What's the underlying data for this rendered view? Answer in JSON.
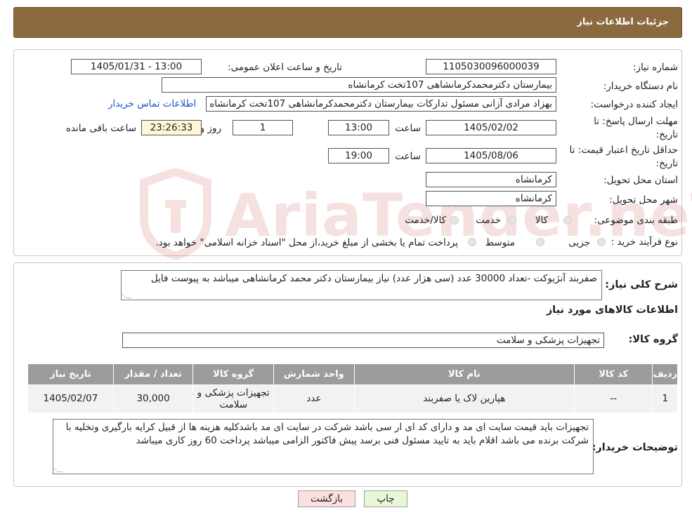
{
  "header": {
    "title": "جزئیات اطلاعات نیاز"
  },
  "watermark": {
    "text": "AriaTender.neT"
  },
  "fields": {
    "need_number_label": "شماره نیاز:",
    "need_number": "1105030096000039",
    "announce_label": "تاریخ و ساعت اعلان عمومی:",
    "announce_value": "1405/01/31 - 13:00",
    "buyer_org_label": "نام دستگاه خریدار:",
    "buyer_org": "بیمارستان دکترمحمدکرمانشاهی 107تخت کرمانشاه",
    "requester_label": "ایجاد کننده درخواست:",
    "requester": "بهزاد مرادی آزانی مسئول تداركات بیمارستان دکترمحمدکرمانشاهی 107تخت کرمانشاه",
    "contact_link": "اطلاعات تماس خریدار",
    "deadline_label_1": "مهلت ارسال پاسخ: تا",
    "deadline_label_2": "تاریخ:",
    "deadline_date": "1405/02/02",
    "time_label": "ساعت",
    "deadline_time": "13:00",
    "days_value": "1",
    "days_label": "روز و",
    "remaining_time": "23:26:33",
    "remaining_label": "ساعت باقی مانده",
    "validity_label_1": "حداقل تاریخ اعتبار قیمت: تا",
    "validity_label_2": "تاریخ:",
    "validity_date": "1405/08/06",
    "validity_time_label": "ساعت",
    "validity_time": "19:00",
    "province_label": "استان محل تحویل:",
    "province": "کرمانشاه",
    "city_label": "شهر محل تحویل:",
    "city": "کرمانشاه",
    "category_label": "طبقه بندی موضوعی:",
    "category_opt_goods": "کالا",
    "category_opt_service": "خدمت",
    "category_opt_both": "کالا/خدمت",
    "process_label": "نوع فرآیند خرید :",
    "process_opt_partial": "جزیی",
    "process_opt_medium": "متوسط",
    "process_note": "پرداخت تمام یا بخشی از مبلغ خرید،از محل \"اسناد خزانه اسلامی\" خواهد بود."
  },
  "summary": {
    "label": "شرح کلی نیاز:",
    "text": "صفربند آنژیوکت -تعداد 30000 عدد (سی هزار عدد) نیاز بیمارستان دکتر محمد کرمانشاهی میباشد به پیوست فایل",
    "goods_info_title": "اطلاعات کالاهای مورد نیاز",
    "group_label": "گروه کالا:",
    "group_value": "تجهیزات پزشکی و سلامت"
  },
  "table": {
    "headers": [
      "ردیف",
      "کد کالا",
      "نام کالا",
      "واحد شمارش",
      "گروه کالا",
      "تعداد / مقدار",
      "تاریخ نیاز"
    ],
    "rows": [
      [
        "1",
        "--",
        "هپارین لاک یا صفربند",
        "عدد",
        "تجهیزات پزشکی و سلامت",
        "30,000",
        "1405/02/07"
      ]
    ]
  },
  "buyer_notes": {
    "label": "توضیحات خریدار:",
    "text": "تجهیزات باید قیمت سایت ای مد و دارای کد ای ار سی باشد شرکت در سایت ای مد باشدکلیه هزینه ها از قبیل کرایه بارگیری وتخلیه با شرکت برنده می باشد اقلام باید به تایید مسئول فنی برسد پیش فاکتور الزامی میباشد پرداخت 60 روز کاری میباشد"
  },
  "buttons": {
    "print": "چاپ",
    "back": "بازگشت"
  },
  "colors": {
    "header_bg": "#8c6a3f",
    "print_bg": "#e8f7d8",
    "back_bg": "#fbe0e0",
    "table_header": "#9c9c9c"
  }
}
